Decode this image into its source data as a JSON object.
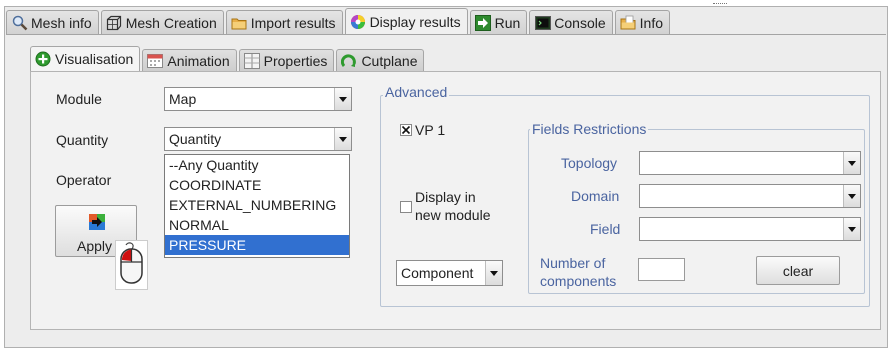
{
  "tabs": [
    {
      "label": "Mesh info",
      "icon": "magnifier-icon"
    },
    {
      "label": "Mesh Creation",
      "icon": "mesh-cube-icon"
    },
    {
      "label": "Import results",
      "icon": "folder-icon"
    },
    {
      "label": "Display results",
      "icon": "color-wheel-icon",
      "active": true
    },
    {
      "label": "Run",
      "icon": "run-arrow-icon"
    },
    {
      "label": "Console",
      "icon": "console-icon"
    },
    {
      "label": "Info",
      "icon": "info-folder-icon"
    }
  ],
  "subtabs": [
    {
      "label": "Visualisation",
      "icon": "green-plus-icon",
      "active": true
    },
    {
      "label": "Animation",
      "icon": "calendar-icon"
    },
    {
      "label": "Properties",
      "icon": "properties-icon"
    },
    {
      "label": "Cutplane",
      "icon": "cutplane-icon"
    }
  ],
  "form": {
    "module_label": "Module",
    "module_value": "Map",
    "quantity_label": "Quantity",
    "quantity_value": "Quantity",
    "operator_label": "Operator",
    "apply_label": "Apply"
  },
  "quantity_dropdown": {
    "options": [
      "--Any Quantity",
      "COORDINATE",
      "EXTERNAL_NUMBERING",
      "NORMAL",
      "PRESSURE"
    ],
    "selected": "PRESSURE"
  },
  "advanced": {
    "title": "Advanced",
    "vp_label": "VP 1",
    "vp_checked": true,
    "display_new_module_line1": "Display in",
    "display_new_module_line2": "new module",
    "display_new_module_checked": false,
    "component_value": "Component"
  },
  "fields_restrictions": {
    "title": "Fields Restrictions",
    "topology_label": "Topology",
    "domain_label": "Domain",
    "field_label": "Field",
    "num_components_line1": "Number of",
    "num_components_line2": "components",
    "num_components_value": "",
    "clear_label": "clear"
  },
  "colors": {
    "selection": "#3170d0",
    "group_title": "#4a64a0"
  }
}
